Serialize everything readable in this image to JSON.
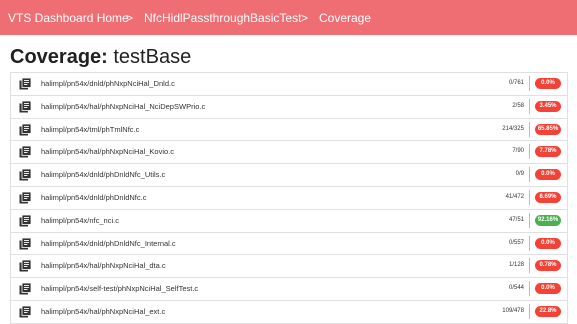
{
  "breadcrumbs": [
    {
      "label": "VTS Dashboard Home"
    },
    {
      "label": "NfcHidlPassthroughBasicTest"
    },
    {
      "label": "Coverage"
    }
  ],
  "breadcrumb_separator": ">",
  "page": {
    "title_prefix": "Coverage:",
    "title_name": "testBase"
  },
  "colors": {
    "header": "#ee6e73",
    "bad": "#f44336",
    "good": "#4caf50"
  },
  "files": [
    {
      "path": "halimpl/pn54x/dnld/phNxpNciHal_Dnld.c",
      "count": "0/761",
      "percent": "0.0%",
      "status": "bad"
    },
    {
      "path": "halimpl/pn54x/hal/phNxpNciHal_NciDepSWPrio.c",
      "count": "2/58",
      "percent": "3.45%",
      "status": "bad"
    },
    {
      "path": "halimpl/pn54x/tml/phTmlNfc.c",
      "count": "214/325",
      "percent": "65.85%",
      "status": "bad"
    },
    {
      "path": "halimpl/pn54x/hal/phNxpNciHal_Kovio.c",
      "count": "7/90",
      "percent": "7.78%",
      "status": "bad"
    },
    {
      "path": "halimpl/pn54x/dnld/phDnldNfc_Utils.c",
      "count": "0/9",
      "percent": "0.0%",
      "status": "bad"
    },
    {
      "path": "halimpl/pn54x/dnld/phDnldNfc.c",
      "count": "41/472",
      "percent": "8.69%",
      "status": "bad"
    },
    {
      "path": "halimpl/pn54x/nfc_nci.c",
      "count": "47/51",
      "percent": "92.16%",
      "status": "good"
    },
    {
      "path": "halimpl/pn54x/dnld/phDnldNfc_Internal.c",
      "count": "0/557",
      "percent": "0.0%",
      "status": "bad"
    },
    {
      "path": "halimpl/pn54x/hal/phNxpNciHal_dta.c",
      "count": "1/128",
      "percent": "0.78%",
      "status": "bad"
    },
    {
      "path": "halimpl/pn54x/self-test/phNxpNciHal_SelfTest.c",
      "count": "0/544",
      "percent": "0.0%",
      "status": "bad"
    },
    {
      "path": "halimpl/pn54x/hal/phNxpNciHal_ext.c",
      "count": "109/478",
      "percent": "22.8%",
      "status": "bad"
    }
  ]
}
